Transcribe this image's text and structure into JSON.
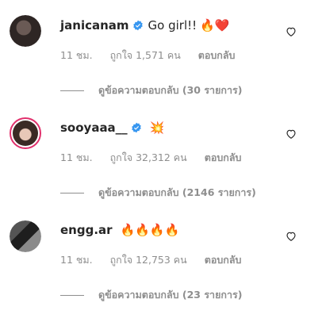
{
  "comments": [
    {
      "username": "janicanam",
      "verified": true,
      "text": "Go girl!!",
      "emoji": "🔥❤️",
      "time": "11 ชม.",
      "likes": "ถูกใจ 1,571 คน",
      "reply": "ตอบกลับ",
      "view_replies": "ดูข้อความตอบกลับ (30 รายการ)"
    },
    {
      "username": "sooyaaa__",
      "verified": true,
      "text": "",
      "emoji": "💥",
      "time": "11 ชม.",
      "likes": "ถูกใจ 32,312 คน",
      "reply": "ตอบกลับ",
      "view_replies": "ดูข้อความตอบกลับ (2146 รายการ)"
    },
    {
      "username": "engg.ar",
      "verified": false,
      "text": "",
      "emoji": "🔥🔥🔥🔥",
      "time": "11 ชม.",
      "likes": "ถูกใจ 12,753 คน",
      "reply": "ตอบกลับ",
      "view_replies": "ดูข้อความตอบกลับ (23 รายการ)"
    }
  ],
  "colors": {
    "verified": "#3897f0",
    "meta": "#8e8e8e",
    "story_ring": "#e1306c"
  }
}
